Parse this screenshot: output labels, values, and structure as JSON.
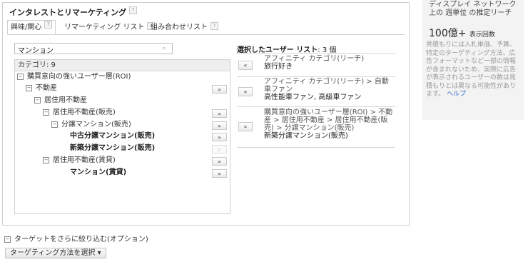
{
  "panel": {
    "title": "インタレストとリマーケティング",
    "help_icon": "?"
  },
  "tabs": [
    {
      "label": "興味/関心",
      "active": true
    },
    {
      "label": "リマーケティング リスト",
      "active": false
    },
    {
      "label": "組み合わせリスト",
      "active": false
    }
  ],
  "search": {
    "value": "マンション",
    "icon": "search-icon"
  },
  "tree": {
    "header": "カテゴリ: 9",
    "add_label": "»",
    "rows": [
      {
        "label": "購買意向の強いユーザー層(ROI)",
        "level": 0,
        "toggle": "⊟",
        "bold": false,
        "add": false
      },
      {
        "label": "不動産",
        "level": 1,
        "toggle": "⊟",
        "bold": false,
        "add": true
      },
      {
        "label": "居住用不動産",
        "level": 2,
        "toggle": "⊟",
        "bold": false,
        "add": false
      },
      {
        "label": "居住用不動産(販売)",
        "level": 3,
        "toggle": "⊟",
        "bold": false,
        "add": true
      },
      {
        "label": "分譲マンション(販売)",
        "level": 4,
        "toggle": "⊟",
        "bold": false,
        "add": true
      },
      {
        "label": "中古分譲マンション(販売)",
        "level": 5,
        "toggle": "",
        "bold": true,
        "add": true
      },
      {
        "label": "新築分譲マンション(販売)",
        "level": 5,
        "toggle": "",
        "bold": true,
        "add": "disabled"
      },
      {
        "label": "居住用不動産(賃貸)",
        "level": 3,
        "toggle": "⊟",
        "bold": false,
        "add": true
      },
      {
        "label": "マンション(賃貸)",
        "level": 5,
        "toggle": "",
        "bold": true,
        "add": true
      }
    ]
  },
  "selected": {
    "heading": "選択したユーザー リスト",
    "count": ": 3 個",
    "remove_label": "«",
    "items": [
      {
        "path": "アフィニティ カテゴリ(リーチ)",
        "name": "旅行好き"
      },
      {
        "path": "アフィニティ カテゴリ(リーチ) > 自動車ファン",
        "name": "高性能車ファン, 高級車ファン"
      },
      {
        "path": "購買意向の強いユーザー層(ROI) > 不動産 > 居住用不動産 > 居住用不動産(販売) > 分譲マンション(販売)",
        "name": "新築分譲マンション(販売)"
      }
    ]
  },
  "sidebar": {
    "reach_label": "ディスプレイ ネットワーク上の 週単位 の推定リーチ",
    "reach_value": "100億+",
    "reach_unit": "表示回数",
    "note": "見積もりには入札単価、予算、特定のターゲティング方法、広告フォーマットなど一部の情報が含まれないため、実際に広告が表示されるユーザーの数は見積もりとは異なる可能性があります。",
    "help_link": "ヘルプ"
  },
  "narrow": {
    "toggle": "⊟",
    "label": "ターゲットをさらに絞り込む(オプション)"
  },
  "method_button": {
    "label": "ターゲティング方法を選択",
    "caret": "▾"
  }
}
